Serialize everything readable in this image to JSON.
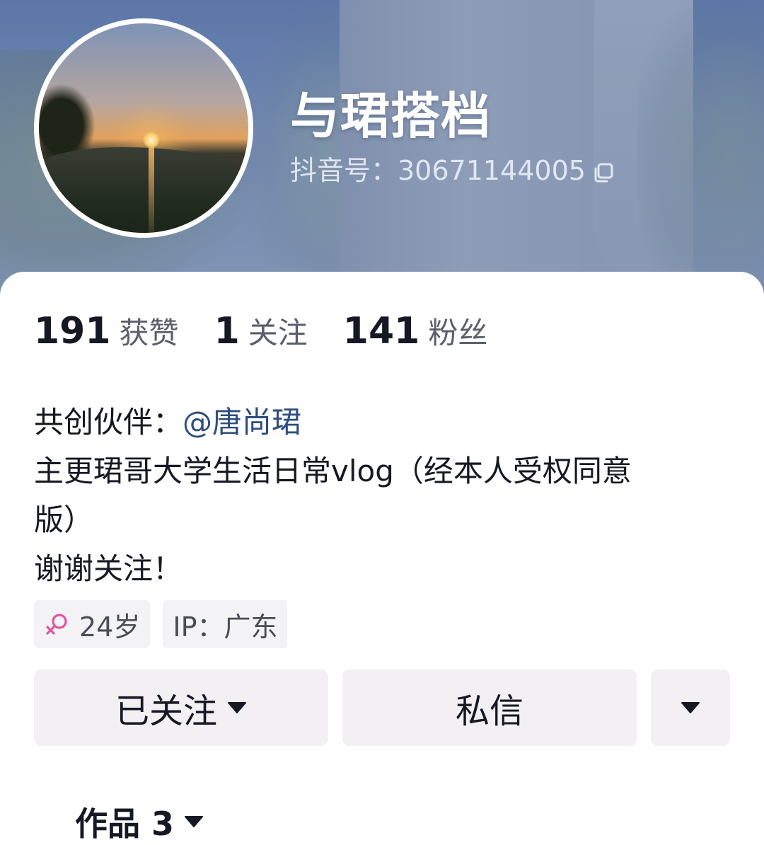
{
  "profile": {
    "nickname": "与珺搭档",
    "douyin_id": "抖音号：30671144005"
  },
  "stats": [
    {
      "value": "191",
      "label": "获赞"
    },
    {
      "value": "1",
      "label": "关注"
    },
    {
      "value": "141",
      "label": "粉丝"
    }
  ],
  "bio": {
    "co_creator_prefix": "共创伙伴：",
    "co_creator_mention": "@唐尚珺",
    "line2": "主更珺哥大学生活日常vlog（经本人受权同意",
    "line3": "版）",
    "line4": "谢谢关注！"
  },
  "tags": {
    "age": "24岁",
    "ip": "IP：广东"
  },
  "actions": {
    "follow_label": "已关注",
    "message_label": "私信"
  },
  "tabs": {
    "works_label": "作品 3"
  },
  "icons": {
    "gender": "female-icon",
    "copy": "copy-icon",
    "caret": "caret-down-icon"
  },
  "colors": {
    "mention": "#2d4e7f",
    "gender_icon": "#e0559a",
    "button_bg": "#f2f0f3"
  }
}
